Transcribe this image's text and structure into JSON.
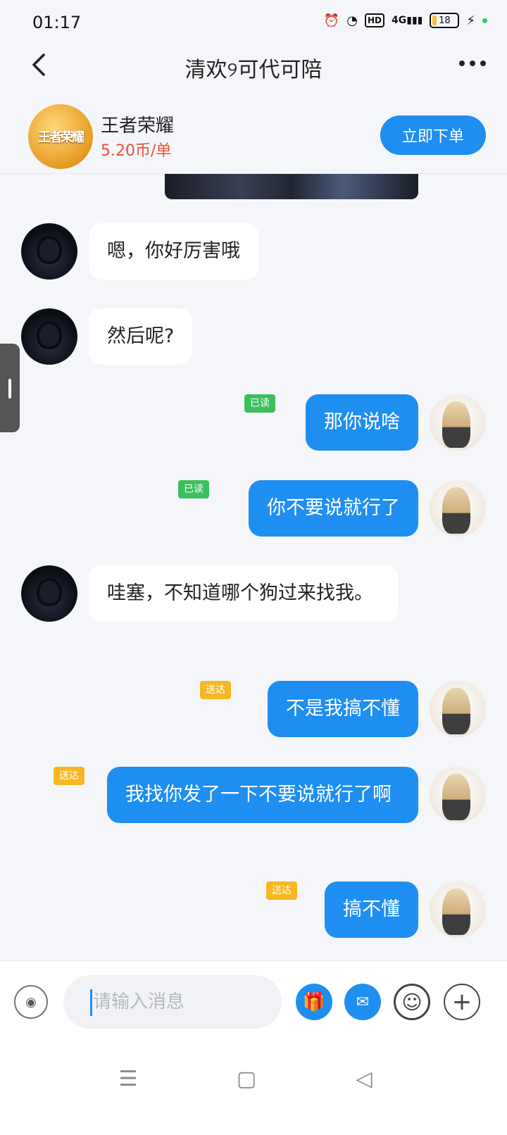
{
  "status_bar": {
    "time": "01:17",
    "hd": "HD",
    "network": "4G",
    "battery": "18"
  },
  "header": {
    "title": "清欢୨可代可陪"
  },
  "service": {
    "game_logo_text": "王者荣耀",
    "game_name": "王者荣耀",
    "price": "5.20币/单",
    "order_button": "立即下单"
  },
  "messages": [
    {
      "side": "left",
      "text": "嗯，你好厉害哦"
    },
    {
      "side": "left",
      "text": "然后呢?"
    },
    {
      "side": "right",
      "text": "那你说啥",
      "status": "已读"
    },
    {
      "side": "right",
      "text": "你不要说就行了",
      "status": "已读"
    },
    {
      "side": "left",
      "text": "哇塞，不知道哪个狗过来找我。"
    },
    {
      "side": "right",
      "text": "不是我搞不懂",
      "status": "送达"
    },
    {
      "side": "right",
      "text": "我找你发了一下不要说就行了啊",
      "status": "送达"
    },
    {
      "side": "right",
      "text": "搞不懂",
      "status": "送达"
    }
  ],
  "input": {
    "placeholder": "请输入消息"
  },
  "colors": {
    "accent": "#1f8ef1",
    "price": "#ea4e3d",
    "read_badge": "#3cbf5f",
    "sent_badge": "#f6b722"
  }
}
